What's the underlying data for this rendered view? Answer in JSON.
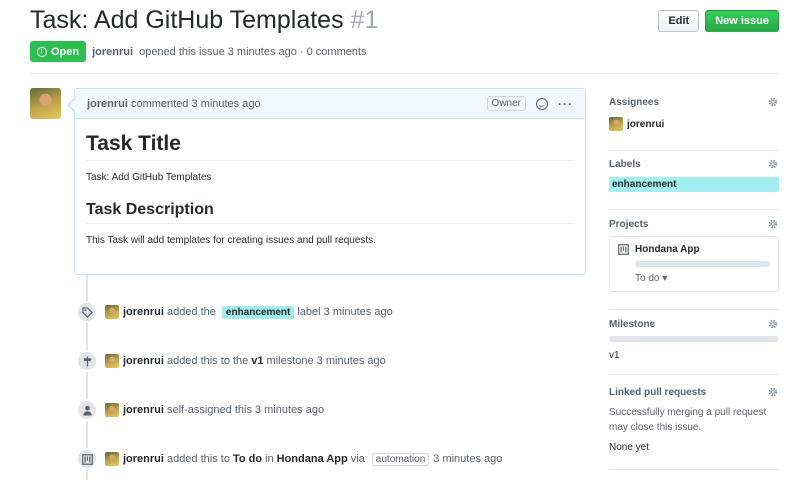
{
  "header": {
    "title": "Task: Add GitHub Templates",
    "number": "#1",
    "edit_label": "Edit",
    "new_issue_label": "New issue"
  },
  "meta": {
    "state": "Open",
    "author": "jorenrui",
    "opened_text": "opened this issue 3 minutes ago · 0 comments"
  },
  "comment": {
    "author": "jorenrui",
    "time": "commented 3 minutes ago",
    "owner_badge": "Owner",
    "h1": "Task Title",
    "p1": "Task: Add GitHub Templates",
    "h2": "Task Description",
    "p2": "This Task will add templates for creating issues and pull requests."
  },
  "timeline": [
    {
      "icon": "tag-icon",
      "user": "jorenrui",
      "pre": "added the",
      "label": "enhancement",
      "post": "label 3 minutes ago"
    },
    {
      "icon": "milestone-icon",
      "user": "jorenrui",
      "pre": "added this to the",
      "bold": "v1",
      "post": "milestone 3 minutes ago"
    },
    {
      "icon": "person-icon",
      "user": "jorenrui",
      "pre": "self-assigned this 3 minutes ago"
    },
    {
      "icon": "project-icon",
      "user": "jorenrui",
      "pre": "added this to",
      "bold": "To do",
      "mid": "in",
      "bold2": "Hondana App",
      "via": "via",
      "pill": "automation",
      "post": "3 minutes ago"
    }
  ],
  "sidebar": {
    "assignees": {
      "title": "Assignees",
      "user": "jorenrui"
    },
    "labels": {
      "title": "Labels",
      "label": "enhancement",
      "color": "#a2eeef"
    },
    "projects": {
      "title": "Projects",
      "name": "Hondana App",
      "column": "To do"
    },
    "milestone": {
      "title": "Milestone",
      "value": "v1"
    },
    "linked": {
      "title": "Linked pull requests",
      "desc": "Successfully merging a pull request may close this issue.",
      "none": "None yet"
    }
  },
  "colors": {
    "open_green": "#2cbe4e",
    "label_cyan": "#a2eeef",
    "link_blue": "#0366d6"
  }
}
